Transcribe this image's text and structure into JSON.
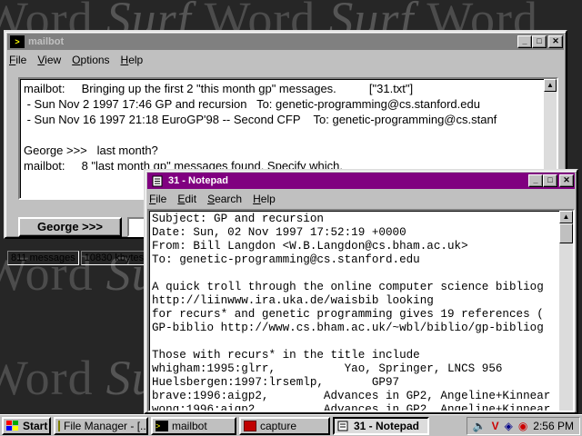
{
  "desktop": {
    "wallpaper_word_a": "Word",
    "wallpaper_word_b": "Surf"
  },
  "mailbot": {
    "title": "mailbot",
    "menu": [
      "File",
      "View",
      "Options",
      "Help"
    ],
    "lines": [
      "mailbot:     Bringing up the first 2 \"this month gp\" messages.          [\"31.txt\"]",
      " - Sun Nov 2 1997 17:46 GP and recursion   To: genetic-programming@cs.stanford.edu",
      " - Sun Nov 16 1997 21:18 EuroGP'98 -- Second CFP    To: genetic-programming@cs.stanf",
      "",
      "George >>>   last month?",
      "mailbot:     8 \"last month gp\" messages found. Specify which."
    ],
    "input_button": "George >>>",
    "status": [
      "811 messages",
      "10830 kbytes"
    ]
  },
  "notepad": {
    "title": "31 - Notepad",
    "menu": [
      "File",
      "Edit",
      "Search",
      "Help"
    ],
    "lines": [
      "Subject: GP and recursion",
      "Date: Sun, 02 Nov 1997 17:52:19 +0000",
      "From: Bill Langdon <W.B.Langdon@cs.bham.ac.uk>",
      "To: genetic-programming@cs.stanford.edu",
      "",
      "A quick troll through the online computer science bibliog",
      "http://liinwww.ira.uka.de/waisbib looking",
      "for recurs* and genetic programming gives 19 references (",
      "GP-biblio http://www.cs.bham.ac.uk/~wbl/biblio/gp-bibliog",
      "",
      "Those with recurs* in the title include",
      "whigham:1995:glrr,          Yao, Springer, LNCS 956",
      "Huelsbergen:1997:lrsemlp,       GP97",
      "brave:1996:aigp2,        Advances in GP2, Angeline+Kinnear",
      "wong:1996:aigp2,         Advances in GP2, Angeline+Kinnear"
    ]
  },
  "taskbar": {
    "start": "Start",
    "tasks": [
      "File Manager - [...",
      "mailbot",
      "capture",
      "31 - Notepad"
    ],
    "clock": "2:56 PM"
  },
  "colors": {
    "active_title": "#800080",
    "inactive_title": "#808080"
  }
}
